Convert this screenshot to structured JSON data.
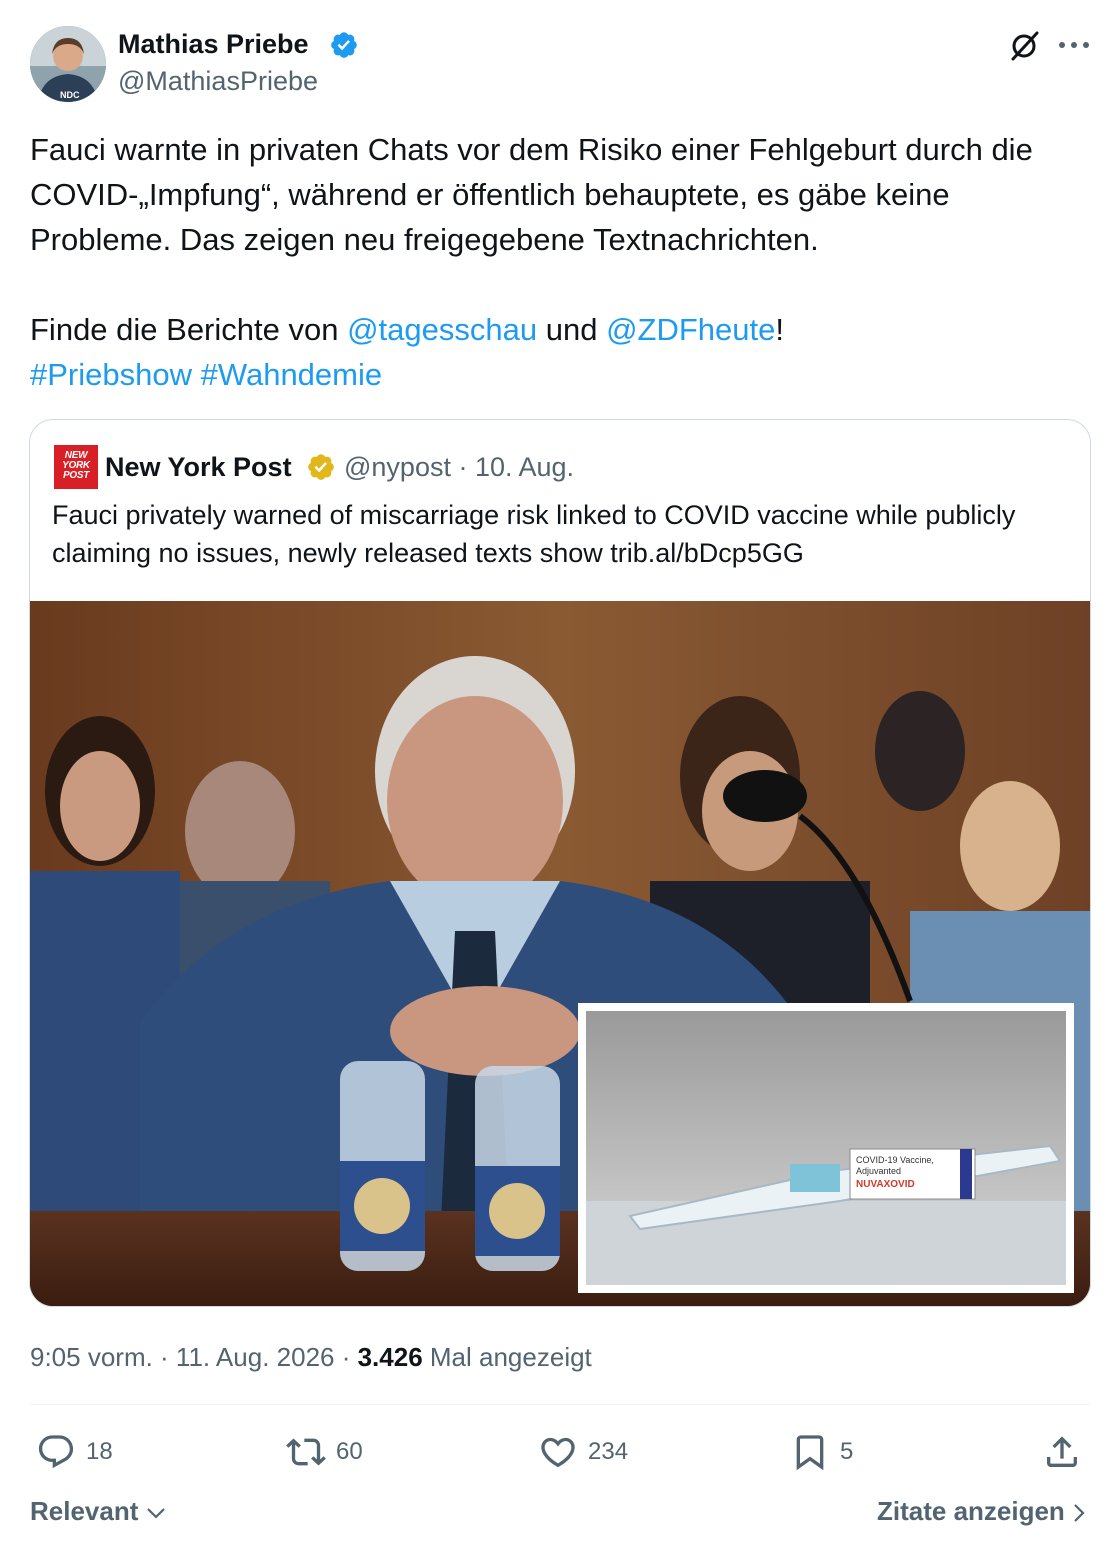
{
  "author": {
    "name": "Mathias Priebe",
    "handle": "@MathiasPriebe",
    "avatar_text": "NDC"
  },
  "tweet": {
    "line1": "Fauci warnte in privaten Chats vor dem Risiko einer Fehlgeburt durch die COVID-„Impfung“, während er öffentlich behauptete, es gäbe keine Probleme. Das zeigen neu freigegebene Textnachrichten.",
    "line2_prefix": "Finde die Berichte von ",
    "mention1": "@tagesschau",
    "line2_middle": " und ",
    "mention2": "@ZDFheute",
    "line2_suffix": "!",
    "hashtag1": "#Priebshow",
    "hashtag2": "#Wahndemie"
  },
  "quote": {
    "logo_text": "NEW YORK POST",
    "name": "New York Post",
    "handle_date": "@nypost · 10. Aug.",
    "text": "Fauci privately warned of miscarriage risk linked to COVID vaccine while publicly claiming no issues, newly released texts show trib.al/bDcp5GG",
    "syringe_label_1": "COVID-19 Vaccine,",
    "syringe_label_2": "Adjuvanted",
    "syringe_label_3": "NUVAXOVID"
  },
  "meta": {
    "time_date": "9:05 vorm. · 11. Aug. 2026 · ",
    "views": "3.426",
    "views_label": " Mal angezeigt"
  },
  "actions": {
    "replies": "18",
    "reposts": "60",
    "likes": "234",
    "bookmarks": "5"
  },
  "footer": {
    "sort_label": "Relevant",
    "quotes_label": "Zitate anzeigen"
  },
  "colors": {
    "accent": "#1d9bf0",
    "secondary_text": "#536471",
    "verified_blue": "#1d9bf0",
    "verified_gold": "#e2b719",
    "nypost_red": "#d81f26"
  }
}
